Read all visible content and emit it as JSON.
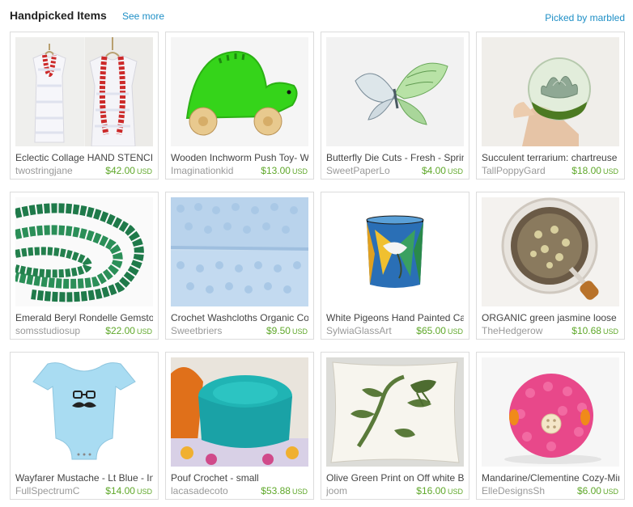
{
  "header": {
    "title": "Handpicked Items",
    "see_more": "See more",
    "picked_by": "Picked by marbled"
  },
  "items": [
    {
      "title": "Eclectic Collage HAND STENCILED",
      "shop": "twostringjane",
      "price": "$42.00",
      "currency": "USD"
    },
    {
      "title": "Wooden Inchworm Push Toy- Wood",
      "shop": "Imaginationkid",
      "price": "$13.00",
      "currency": "USD"
    },
    {
      "title": "Butterfly Die Cuts - Fresh - Spring",
      "shop": "SweetPaperLo",
      "price": "$4.00",
      "currency": "USD"
    },
    {
      "title": "Succulent terrarium: chartreuse",
      "shop": "TallPoppyGard",
      "price": "$18.00",
      "currency": "USD"
    },
    {
      "title": "Emerald Beryl Rondelle Gemstone",
      "shop": "somsstudiosup",
      "price": "$22.00",
      "currency": "USD"
    },
    {
      "title": "Crochet Washcloths Organic Cotton",
      "shop": "Sweetbriers",
      "price": "$9.50",
      "currency": "USD"
    },
    {
      "title": "White Pigeons Hand Painted Candle",
      "shop": "SylwiaGlassArt",
      "price": "$65.00",
      "currency": "USD"
    },
    {
      "title": "ORGANIC green jasmine loose",
      "shop": "TheHedgerow",
      "price": "$10.68",
      "currency": "USD"
    },
    {
      "title": "Wayfarer Mustache - Lt Blue - Infant",
      "shop": "FullSpectrumC",
      "price": "$14.00",
      "currency": "USD"
    },
    {
      "title": "Pouf Crochet - small",
      "shop": "lacasadecoto",
      "price": "$53.88",
      "currency": "USD"
    },
    {
      "title": "Olive Green Print on Off white Burlap",
      "shop": "joom",
      "price": "$16.00",
      "currency": "USD"
    },
    {
      "title": "Mandarine/Clementine Cozy-Mini",
      "shop": "ElleDesignsSh",
      "price": "$6.00",
      "currency": "USD"
    }
  ],
  "colors": {
    "link": "#1e8fc6",
    "price": "#5fa82a",
    "shop": "#999999",
    "border": "#dcdcdc"
  }
}
